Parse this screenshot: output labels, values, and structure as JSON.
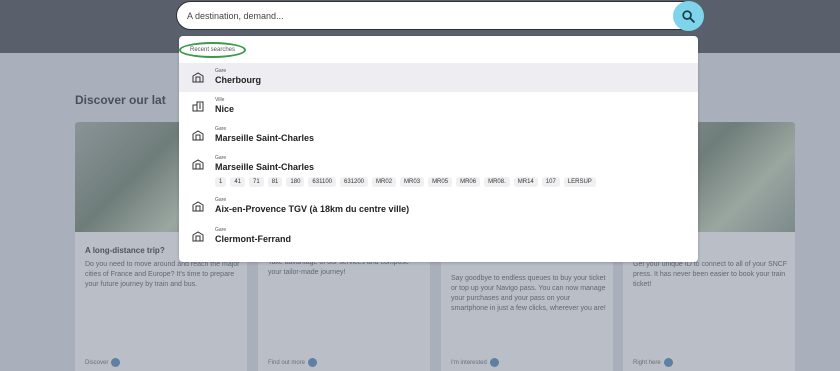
{
  "search": {
    "placeholder": "A destination, demand..."
  },
  "dropdown": {
    "recent_label": "Recent searches",
    "items": [
      {
        "type": "Gare",
        "name": "Cherbourg",
        "icon": "train-station-icon"
      },
      {
        "type": "Ville",
        "name": "Nice",
        "icon": "city-icon"
      },
      {
        "type": "Gare",
        "name": "Marseille Saint-Charles",
        "icon": "train-station-icon"
      },
      {
        "type": "Gare",
        "name": "Marseille Saint-Charles",
        "icon": "train-station-icon"
      },
      {
        "type": "Gare",
        "name": "Aix-en-Provence TGV (à 18km du centre ville)",
        "icon": "train-station-icon"
      },
      {
        "type": "Gare",
        "name": "Clermont-Ferrand",
        "icon": "train-station-icon"
      }
    ],
    "lines": [
      "1",
      "41",
      "71",
      "81",
      "180",
      "631100",
      "631200",
      "MR02",
      "MR03",
      "MR05",
      "MR06",
      "MR08.",
      "MR14",
      "107",
      "LERSUP"
    ]
  },
  "background": {
    "discover_title": "Discover our lat",
    "cards": [
      {
        "title": "A long-distance trip?",
        "text": "Do you need to move around and reach the major cities of France and Europe? It's time to prepare your future journey by train and bus.",
        "link": "Discover"
      },
      {
        "title": "",
        "text": "Take advantage of our services and compose your tailor-made journey!",
        "link": "Find out more"
      },
      {
        "title": "",
        "text": "Say goodbye to endless queues to buy your ticket or top up your Navigo pass. You can now manage your purchases and your pass on your smartphone in just a few clicks, wherever you are!",
        "link": "I'm interested"
      },
      {
        "title": "",
        "text": "Get your unique ID to connect to all of your SNCF press. It has never been easier to book your train ticket!",
        "link": "Right here"
      }
    ]
  },
  "colors": {
    "search_button": "#7ed4ea",
    "highlight_ring": "#3a9a4a",
    "overlay_header": "#59606c"
  }
}
